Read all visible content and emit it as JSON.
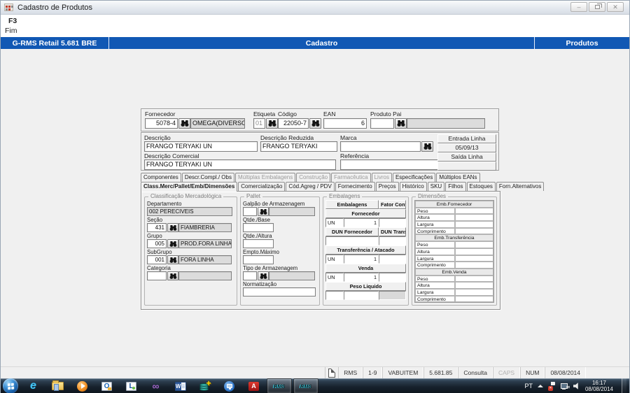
{
  "window": {
    "title": "Cadastro de Produtos",
    "controls": {
      "minimize": "–",
      "close": "✕"
    }
  },
  "menu": {
    "f3": "F3",
    "fim": "Fim"
  },
  "banner": {
    "left": "G-RMS Retail 5.681 BRE",
    "center": "Cadastro",
    "right": "Produtos",
    "color": "#1158b4"
  },
  "form": {
    "fornecedor_label": "Fornecedor",
    "fornecedor_code": "5078-4",
    "fornecedor_name": "OMEGA(DIVERSOS)",
    "etiqueta_label": "Etiqueta",
    "etiqueta_value": "01",
    "codigo_label": "Código",
    "codigo_value": "22050-7",
    "ean_label": "EAN",
    "ean_value": "6",
    "produto_pai_label": "Produto Pai",
    "produto_pai_value": "",
    "produto_pai_name": "",
    "descricao_label": "Descrição",
    "descricao_value": "FRANGO TERYAKI UN",
    "descricao_reduzida_label": "Descrição Reduzida",
    "descricao_reduzida_value": "FRANGO TERYAKI",
    "marca_label": "Marca",
    "marca_value": "",
    "descricao_comercial_label": "Descrição Comercial",
    "descricao_comercial_value": "FRANGO TERYAKI UN",
    "referencia_label": "Referência",
    "referencia_value": "",
    "entrada_linha_label": "Entrada Linha",
    "entrada_linha_value": "05/09/13",
    "saida_linha_label": "Saída Linha",
    "saida_linha_value": ""
  },
  "tabs_row1": [
    {
      "label": "Componentes",
      "state": "enabled"
    },
    {
      "label": "Descr.Compl./ Obs",
      "state": "enabled"
    },
    {
      "label": "Múltiplas Embalagens",
      "state": "disabled"
    },
    {
      "label": "Construção",
      "state": "disabled"
    },
    {
      "label": "Farmacêutica",
      "state": "disabled"
    },
    {
      "label": "Livros",
      "state": "disabled"
    },
    {
      "label": "Especificações",
      "state": "enabled"
    },
    {
      "label": "Múltiplos EANs",
      "state": "enabled"
    }
  ],
  "tabs_row2": [
    {
      "label": "Class.Merc/Pallet/Emb/Dimensões",
      "state": "active"
    },
    {
      "label": "Comercialização",
      "state": "enabled"
    },
    {
      "label": "Cód.Agreg / PDV",
      "state": "enabled"
    },
    {
      "label": "Fornecimento",
      "state": "enabled"
    },
    {
      "label": "Preços",
      "state": "enabled"
    },
    {
      "label": "Histórico",
      "state": "enabled"
    },
    {
      "label": "SKU",
      "state": "enabled"
    },
    {
      "label": "Filhos",
      "state": "enabled"
    },
    {
      "label": "Estoques",
      "state": "enabled"
    },
    {
      "label": "Forn.Alternativos",
      "state": "enabled"
    }
  ],
  "classificacao": {
    "title": "Classificação Mercadológica",
    "departamento_label": "Departamento",
    "departamento_value": "002 PERECIVEIS",
    "secao_label": "Seção",
    "secao_code": "431",
    "secao_name": "FIAMBRERIA",
    "grupo_label": "Grupo",
    "grupo_code": "005",
    "grupo_name": "PROD.FORA LINHA",
    "subgrupo_label": "SubGrupo",
    "subgrupo_code": "001",
    "subgrupo_name": "FORA LINHA",
    "categoria_label": "Categoria",
    "categoria_code": "",
    "categoria_name": ""
  },
  "pallet": {
    "title": "Pallet",
    "galpao_label": "Galpão de Armazenagem",
    "galpao_code": "",
    "galpao_name": "",
    "qtde_base_label": "Qtde./Base",
    "qtde_base_value": "",
    "qtde_altura_label": "Qtde./Altura",
    "qtde_altura_value": "",
    "empto_maximo_label": "Empto.Máximo",
    "empto_maximo_value": "",
    "tipo_armazenagem_label": "Tipo de Armazenagem",
    "tipo_code": "",
    "tipo_name": "",
    "normatizacao_label": "Normatização",
    "normatizacao_value": ""
  },
  "embalagens": {
    "title": "Embalagens",
    "col_embalagens": "Embalagens",
    "col_fator": "Fator Conversão",
    "sec_fornecedor": "Fornecedor",
    "fornecedor_un": "UN",
    "fornecedor_qty": "1",
    "fornecedor_fator": "",
    "dun_fornecedor_label": "DUN Fornecedor",
    "dun_transf_label": "DUN Transf",
    "dun_fornecedor_value": "",
    "dun_transf_value": "",
    "sec_transferencia": "Transferência / Atacado",
    "transferencia_un": "UN",
    "transferencia_qty": "1",
    "transferencia_fator": "",
    "sec_venda": "Venda",
    "venda_un": "UN",
    "venda_qty": "1",
    "venda_fator": "",
    "sec_peso": "Peso Liquido",
    "peso_value": ""
  },
  "dimensoes": {
    "title": "Dimensões",
    "sections": [
      {
        "title": "Emb.Fornecedor",
        "rows": [
          {
            "label": "Peso",
            "value": ""
          },
          {
            "label": "Altura",
            "value": ""
          },
          {
            "label": "Largura",
            "value": ""
          },
          {
            "label": "Comprimento",
            "value": ""
          }
        ]
      },
      {
        "title": "Emb.Transferência",
        "rows": [
          {
            "label": "Peso",
            "value": ""
          },
          {
            "label": "Altura",
            "value": ""
          },
          {
            "label": "Largura",
            "value": ""
          },
          {
            "label": "Comprimento",
            "value": ""
          }
        ]
      },
      {
        "title": "Emb.Venda",
        "rows": [
          {
            "label": "Peso",
            "value": ""
          },
          {
            "label": "Altura",
            "value": ""
          },
          {
            "label": "Largura",
            "value": ""
          },
          {
            "label": "Comprimento",
            "value": ""
          }
        ]
      }
    ]
  },
  "statusbar": {
    "cells": [
      {
        "label": "RMS"
      },
      {
        "label": "1-9"
      },
      {
        "label": "VABUITEM"
      },
      {
        "label": "5.681.85"
      },
      {
        "label": "Consulta"
      },
      {
        "label": "CAPS"
      },
      {
        "label": "NUM"
      },
      {
        "label": "08/08/2014"
      }
    ]
  },
  "taskbar": {
    "tray_lang": "PT",
    "tray_time": "16:17",
    "tray_date": "08/08/2014",
    "icons": [
      {
        "name": "start",
        "glyph": ""
      },
      {
        "name": "internet-explorer",
        "glyph": "e"
      },
      {
        "name": "file-explorer",
        "glyph": ""
      },
      {
        "name": "media-player",
        "glyph": ""
      },
      {
        "name": "outlook",
        "glyph": "O"
      },
      {
        "name": "lync",
        "glyph": "L"
      },
      {
        "name": "visual-studio",
        "glyph": "∞"
      },
      {
        "name": "word",
        "glyph": "W"
      },
      {
        "name": "database-tool",
        "glyph": "+"
      },
      {
        "name": "remote-desktop",
        "glyph": ""
      },
      {
        "name": "adobe-reader",
        "glyph": "A"
      },
      {
        "name": "rms-session-1",
        "glyph": "RMS"
      },
      {
        "name": "rms-session-2",
        "glyph": "RMS"
      }
    ]
  }
}
